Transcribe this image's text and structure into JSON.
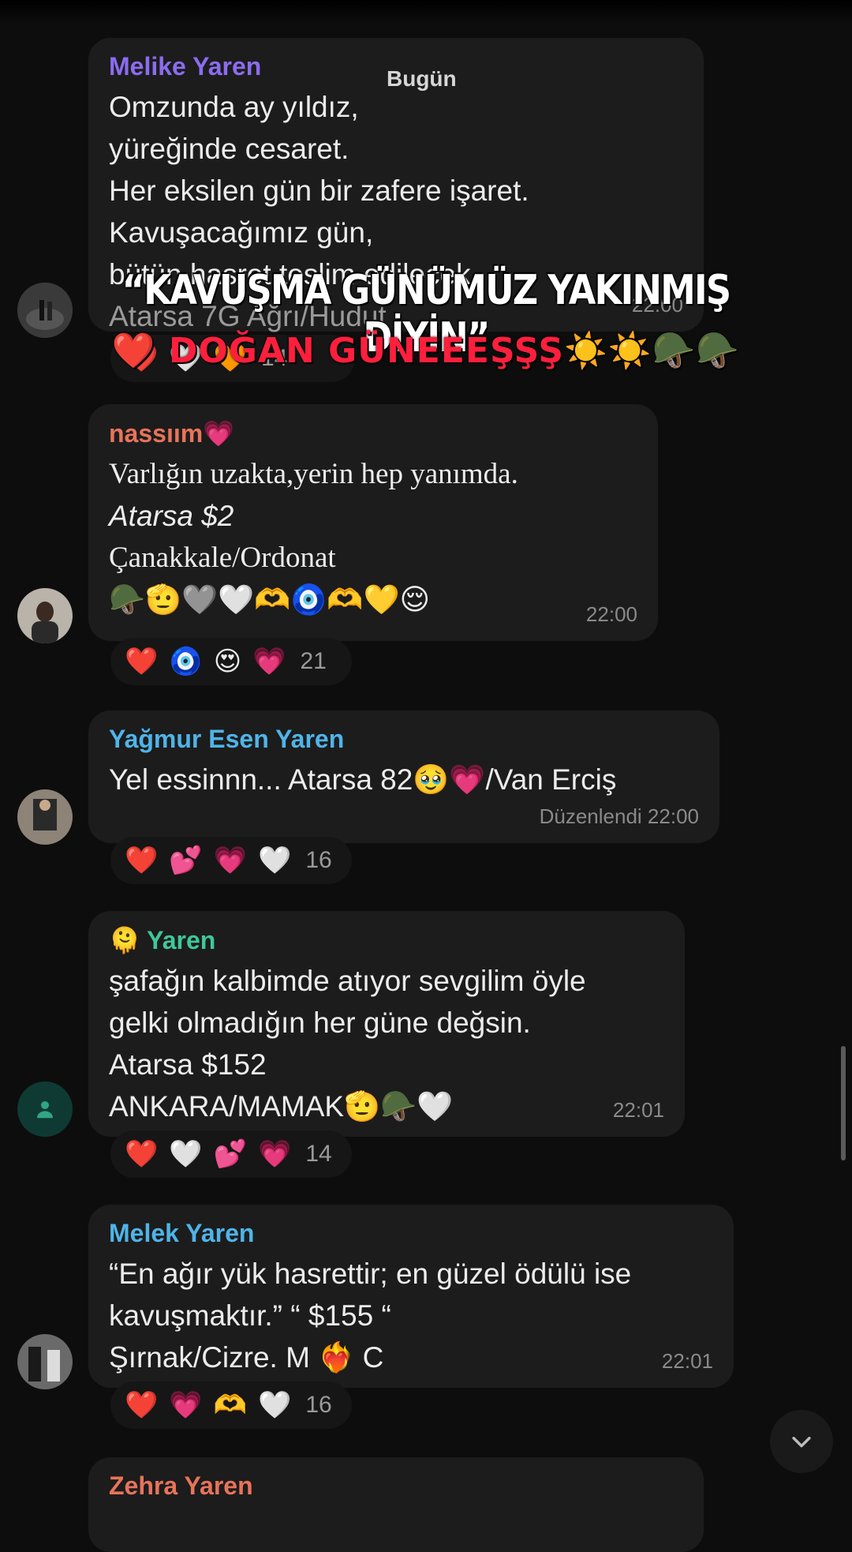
{
  "header": {
    "day_label": "Bugün"
  },
  "overlay": {
    "title": "“KAVUŞMA GÜNÜMÜZ YAKINMIŞ DİYİN”",
    "subtitle": "❤️ DOĞAN GÜNEEEŞŞŞ☀️☀️🪖🪖"
  },
  "messages": [
    {
      "sender": "Melike Yaren",
      "sender_color": "#8b6cf0",
      "lines": [
        "Omzunda ay yıldız,",
        "yüreğinde cesaret.",
        "Her eksilen gün bir zafere işaret.",
        "Kavuşacağımız gün,",
        "bütün hasret teslim edilecek.",
        "Atarsa 7G Ağrı/Hudut"
      ],
      "time": "22:00",
      "reactions": {
        "emojis": [
          "❤️",
          "🤍",
          "🧡"
        ],
        "count": "14"
      }
    },
    {
      "sender": "nassıım💗",
      "sender_color": "#e8735a",
      "lines": [
        "Varlığın uzakta,yerin hep yanımda.",
        "Atarsa $2",
        "Çanakkale/Ordonat",
        "🪖🫡🩶🤍🫶🧿🫶💛😌"
      ],
      "time": "22:00",
      "reactions": {
        "emojis": [
          "❤️",
          "🧿",
          "😍",
          "💗"
        ],
        "count": "21"
      }
    },
    {
      "sender": "Yağmur Esen Yaren",
      "sender_color": "#4fb4e8",
      "lines": [
        "Yel essinnn... Atarsa 82🥹💗/Van Erciş"
      ],
      "time": "Düzenlendi 22:00",
      "reactions": {
        "emojis": [
          "❤️",
          "💕",
          "💗",
          "🤍"
        ],
        "count": "16"
      }
    },
    {
      "sender": "🫠 Yaren",
      "sender_color": "#3fc79a",
      "lines": [
        "şafağın kalbimde atıyor sevgilim öyle",
        "gelki olmadığın her güne değsin.",
        "Atarsa $152",
        "ANKARA/MAMAK🫡🪖🤍"
      ],
      "time": "22:01",
      "reactions": {
        "emojis": [
          "❤️",
          "🤍",
          "💕",
          "💗"
        ],
        "count": "14"
      }
    },
    {
      "sender": "Melek Yaren",
      "sender_color": "#4fb4e8",
      "lines": [
        "“En ağır yük hasrettir; en güzel ödülü ise",
        "kavuşmaktır.”  “ $155 “",
        "Şırnak/Cizre.  M ❤️‍🔥 C"
      ],
      "time": "22:01",
      "reactions": {
        "emojis": [
          "❤️",
          "💗",
          "🫶",
          "🤍"
        ],
        "count": "16"
      }
    },
    {
      "sender": "Zehra Yaren",
      "sender_color": "#e8735a",
      "lines": [],
      "time": "",
      "reactions": null
    }
  ],
  "icons": {
    "scroll_down": "chevron-down-icon",
    "default_avatar": "person-icon"
  }
}
